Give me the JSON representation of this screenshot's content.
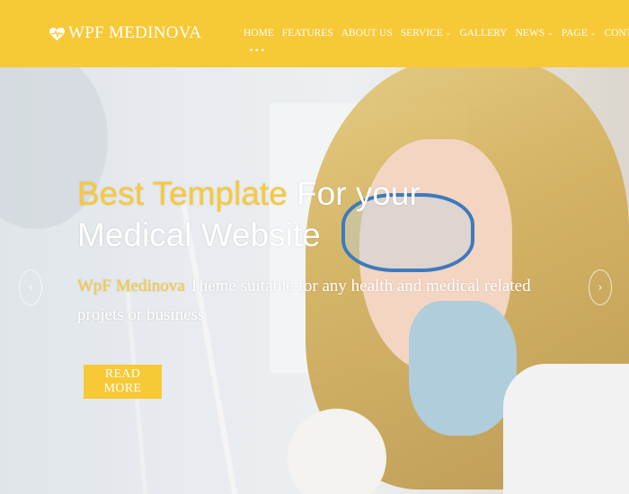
{
  "header": {
    "logo_text": "WPF MEDINOVA",
    "logo_icon": "heart-pulse-icon",
    "brand_color": "#f8c936"
  },
  "nav": {
    "items": [
      {
        "label": "HOME",
        "dropdown": false
      },
      {
        "label": "FEATURES",
        "dropdown": false
      },
      {
        "label": "ABOUT US",
        "dropdown": false
      },
      {
        "label": "SERVICE",
        "dropdown": true
      },
      {
        "label": "GALLERY",
        "dropdown": false
      },
      {
        "label": "NEWS",
        "dropdown": true
      },
      {
        "label": "PAGE",
        "dropdown": true
      },
      {
        "label": "CONTACT",
        "dropdown": false
      }
    ],
    "more_label": "•••"
  },
  "hero": {
    "headline_accent": "Best Template",
    "headline_rest": " For your Medical Website",
    "sub_accent": "WpF Medinova",
    "sub_rest": " Theme suitable for any health and medical related projets or business",
    "button_label": "READ MORE",
    "prev_icon": "chevron-left-icon",
    "next_icon": "chevron-right-icon"
  }
}
